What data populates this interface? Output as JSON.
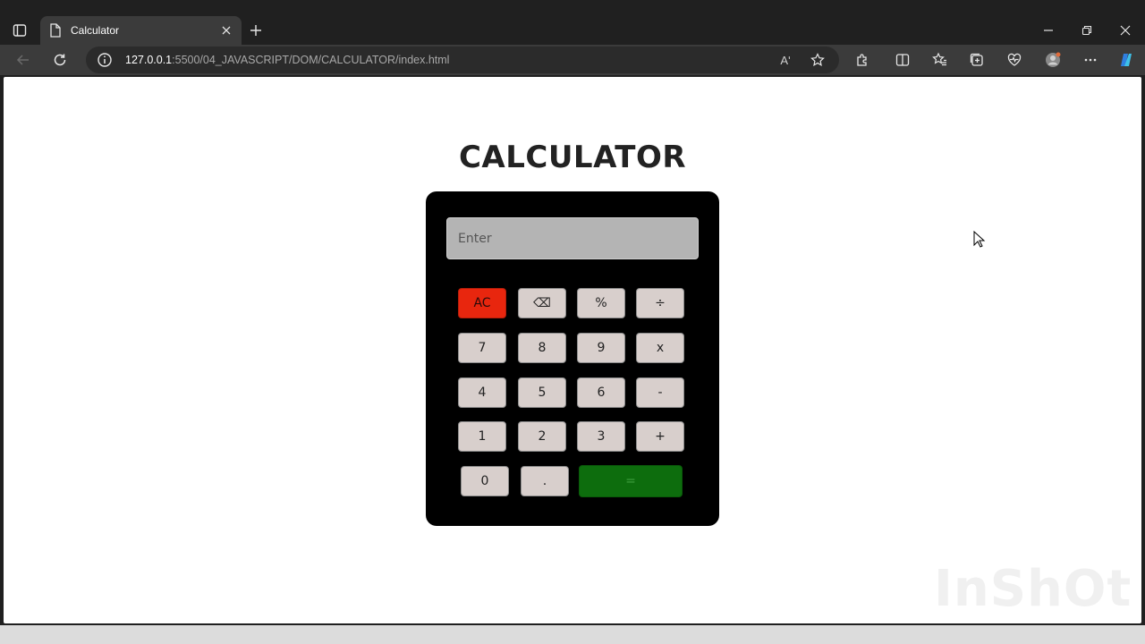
{
  "browser": {
    "tab_title": "Calculator",
    "url_host": "127.0.0.1",
    "url_rest": ":5500/04_JAVASCRIPT/DOM/CALCULATOR/index.html",
    "read_aloud_glyph": "Aʹ"
  },
  "page": {
    "heading": "CALCULATOR",
    "display_placeholder": "Enter",
    "keys": {
      "ac": "AC",
      "backspace": "⌫",
      "percent": "%",
      "divide": "÷",
      "seven": "7",
      "eight": "8",
      "nine": "9",
      "multiply": "x",
      "four": "4",
      "five": "5",
      "six": "6",
      "minus": "-",
      "one": "1",
      "two": "2",
      "three": "3",
      "plus": "+",
      "zero": "0",
      "dot": ".",
      "equals": "="
    }
  },
  "watermark": "InShOt",
  "colors": {
    "ac_key": "#e8260e",
    "equals_key": "#0d6d0d",
    "key": "#d8cfcc",
    "calc_body": "#000000",
    "display": "#b4b4b4"
  }
}
